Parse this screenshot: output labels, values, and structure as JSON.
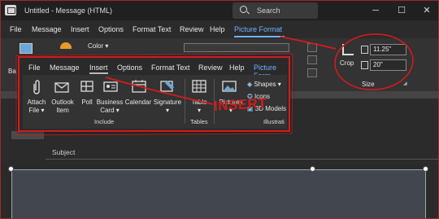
{
  "window": {
    "title": "Untitled - Message (HTML)",
    "search_placeholder": "Search",
    "minimize": "─",
    "maximize": "☐",
    "close": "✕"
  },
  "menu": {
    "items": [
      "File",
      "Message",
      "Insert",
      "Options",
      "Format Text",
      "Review",
      "Help",
      "Picture Format"
    ],
    "active": "Picture Format"
  },
  "ribbon_bg": {
    "left_label": "Ba",
    "color_label": "Color",
    "crop_label": "Crop",
    "height_value": "11.25\"",
    "width_value": "20\"",
    "size_group": "Size"
  },
  "inset": {
    "menu_items": [
      "File",
      "Message",
      "Insert",
      "Options",
      "Format Text",
      "Review",
      "Help",
      "Picture Form"
    ],
    "active": "Insert",
    "tools": {
      "attach_file": "Attach File",
      "outlook_item": "Outlook Item",
      "poll": "Poll",
      "business_card": "Business Card",
      "calendar": "Calendar",
      "signature": "Signature",
      "table": "Table",
      "pictures": "Pictures",
      "shapes": "Shapes",
      "icons": "Icons",
      "models": "3D Models"
    },
    "groups": {
      "include": "Include",
      "tables": "Tables",
      "illustrations": "Illustrati"
    }
  },
  "annotation": {
    "text": "INSERT",
    "color": "#d11c1c"
  },
  "message": {
    "subject_label": "Subject"
  }
}
